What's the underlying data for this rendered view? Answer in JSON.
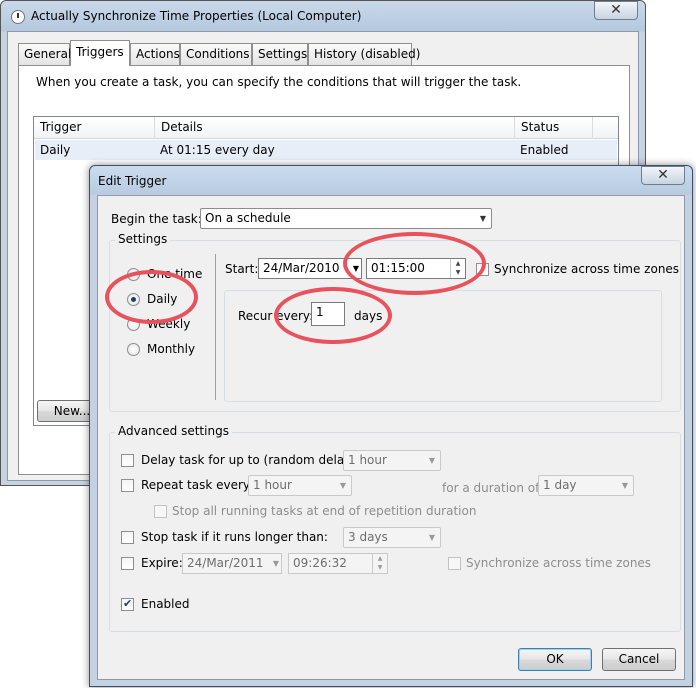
{
  "back_window": {
    "title": "Actually Synchronize Time Properties (Local Computer)",
    "close_glyph": "✕",
    "tabs": [
      "General",
      "Triggers",
      "Actions",
      "Conditions",
      "Settings",
      "History (disabled)"
    ],
    "active_tab": "Triggers",
    "description": "When you create a task, you can specify the conditions that will trigger the task.",
    "trigger_list": {
      "columns": [
        "Trigger",
        "Details",
        "Status"
      ],
      "rows": [
        {
          "trigger": "Daily",
          "details": "At 01:15 every day",
          "status": "Enabled"
        }
      ]
    },
    "new_button": "New..."
  },
  "dialog": {
    "title": "Edit Trigger",
    "close_glyph": "✕",
    "begin_label": "Begin the task:",
    "begin_value": "On a schedule",
    "settings": {
      "title": "Settings",
      "radios": [
        "One time",
        "Daily",
        "Weekly",
        "Monthly"
      ],
      "selected": "Daily",
      "start_label": "Start:",
      "start_date": "24/Mar/2010",
      "start_time": "01:15:00",
      "sync_label": "Synchronize across time zones",
      "recur_label": "Recur every:",
      "recur_value": "1",
      "recur_unit": "days"
    },
    "advanced": {
      "title": "Advanced settings",
      "delay_label": "Delay task for up to (random delay):",
      "delay_value": "1 hour",
      "repeat_label": "Repeat task every:",
      "repeat_value": "1 hour",
      "duration_label": "for a duration of:",
      "duration_value": "1 day",
      "stop_all_label": "Stop all running tasks at end of repetition duration",
      "stop_if_label": "Stop task if it runs longer than:",
      "stop_if_value": "3 days",
      "expire_label": "Expire:",
      "expire_date": "24/Mar/2011",
      "expire_time": "09:26:32",
      "expire_sync_label": "Synchronize across time zones",
      "enabled_label": "Enabled"
    },
    "ok_button": "OK",
    "cancel_button": "Cancel"
  },
  "colors": {
    "annotation_circle": "#e8525c",
    "selection_row": "#e8eef7"
  }
}
